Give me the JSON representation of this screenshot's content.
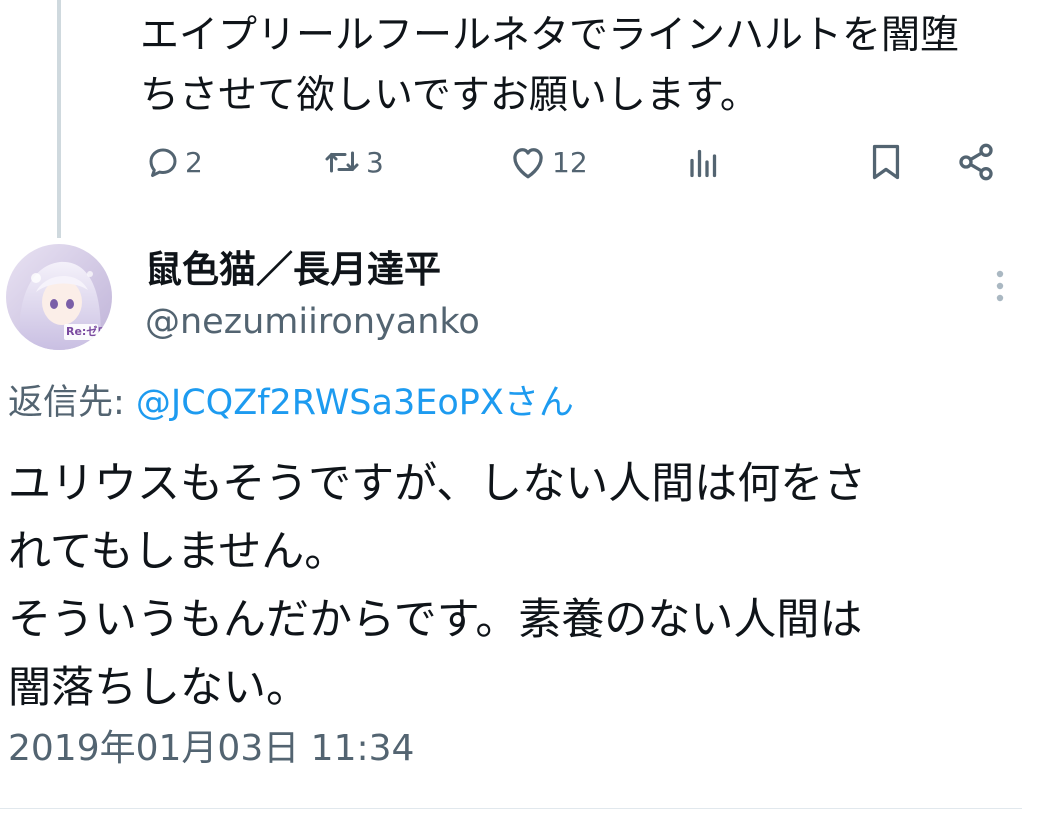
{
  "previous_tweet": {
    "text": "エイプリールフールネタでラインハルトを闇堕\nちさせて欲しいですお願いします。",
    "actions": {
      "reply_count": "2",
      "retweet_count": "3",
      "like_count": "12"
    }
  },
  "tweet": {
    "display_name": "鼠色猫／長月達平",
    "handle": "@nezumiironyanko",
    "avatar_text": "Re:ゼロ",
    "reply_label": "返信先: ",
    "reply_target": "@JCQZf2RWSa3EoPXさん",
    "body": "ユリウスもそうですが、しない人間は何をさ\nれてもしません。\nそういうもんだからです。素養のない人間は\n闇落ちしない。",
    "timestamp": "2019年01月03日 11:34"
  },
  "colors": {
    "text": "#0f1419",
    "secondary": "#536471",
    "link": "#1d9bf0",
    "thread_line": "#cfd9de"
  },
  "icons": [
    "reply-icon",
    "retweet-icon",
    "like-icon",
    "views-icon",
    "bookmark-icon",
    "share-icon",
    "more-options-icon"
  ]
}
